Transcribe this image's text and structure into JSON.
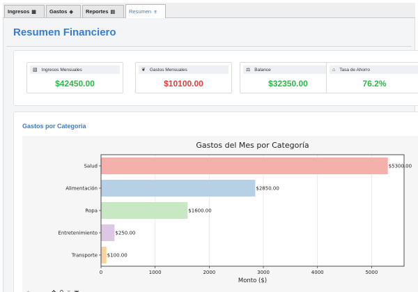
{
  "tabs": [
    {
      "label": "Ingresos",
      "icon": "wallet-icon",
      "glyph": "▦"
    },
    {
      "label": "Gastos",
      "icon": "card-icon",
      "glyph": "◈"
    },
    {
      "label": "Reportes",
      "icon": "report-icon",
      "glyph": "▤"
    },
    {
      "label": "Resumen",
      "icon": "summary-icon",
      "glyph": "⌆"
    }
  ],
  "page_title": "Resumen Financiero",
  "cards": [
    {
      "label": "Ingresos Mensuales",
      "value": "$42450.00",
      "icon": "receipt-icon",
      "glyph": "▧",
      "color": "#2bb84a"
    },
    {
      "label": "Gastos Mensuales",
      "value": "$10100.00",
      "icon": "money-bag-icon",
      "glyph": "❦",
      "color": "#e23b3b"
    },
    {
      "label": "Balance",
      "value": "$32350.00",
      "icon": "scale-icon",
      "glyph": "⚖",
      "color": "#2bb84a"
    },
    {
      "label": "Tasa de Ahorro",
      "value": "76.2%",
      "icon": "bank-icon",
      "glyph": "⌂",
      "color": "#2bb84a"
    }
  ],
  "section_title": "Gastos por Categoria",
  "chart_data": {
    "type": "bar",
    "orientation": "horizontal",
    "title": "Gastos del Mes por Categoría",
    "xlabel": "Monto ($)",
    "ylabel": "",
    "categories": [
      "Transporte",
      "Entretenimiento",
      "Ropa",
      "Alimentación",
      "Salud"
    ],
    "values": [
      100,
      250,
      1600,
      2850,
      5300
    ],
    "value_labels": [
      "$100.00",
      "$250.00",
      "$1600.00",
      "$2850.00",
      "$5300.00"
    ],
    "colors": [
      "#f6d4a1",
      "#dcc8e2",
      "#c7e8c2",
      "#b6d0e6",
      "#f6b0ac"
    ],
    "xlim": [
      0,
      5600
    ],
    "xticks": [
      0,
      1000,
      2000,
      3000,
      4000,
      5000
    ],
    "grid": true
  },
  "toolbar_glyphs": [
    "⌂",
    "←",
    "→",
    "✥",
    "⚲",
    "≡",
    "▣"
  ]
}
